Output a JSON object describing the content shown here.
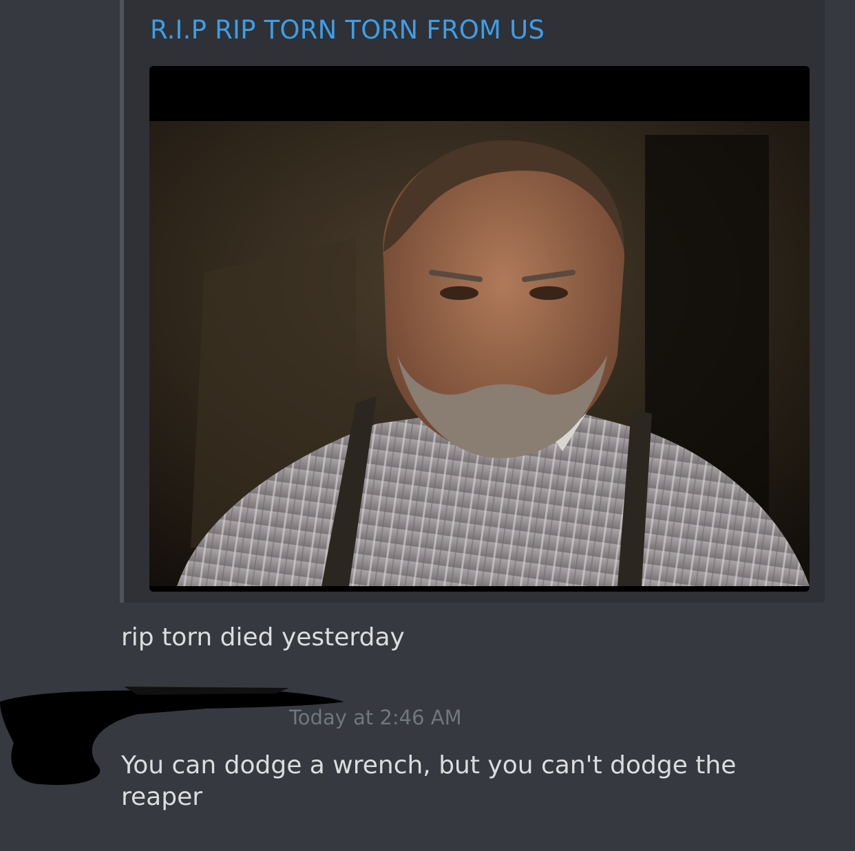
{
  "embed": {
    "title": "R.I.P RIP TORN TORN FROM US",
    "accent_color": "#4f545c",
    "title_color": "#3d9ee8"
  },
  "messages": [
    {
      "text": "rip torn died yesterday"
    },
    {
      "timestamp": "Today at 2:46 AM",
      "text": "You can dodge a wrench, but you can't dodge the reaper"
    }
  ]
}
